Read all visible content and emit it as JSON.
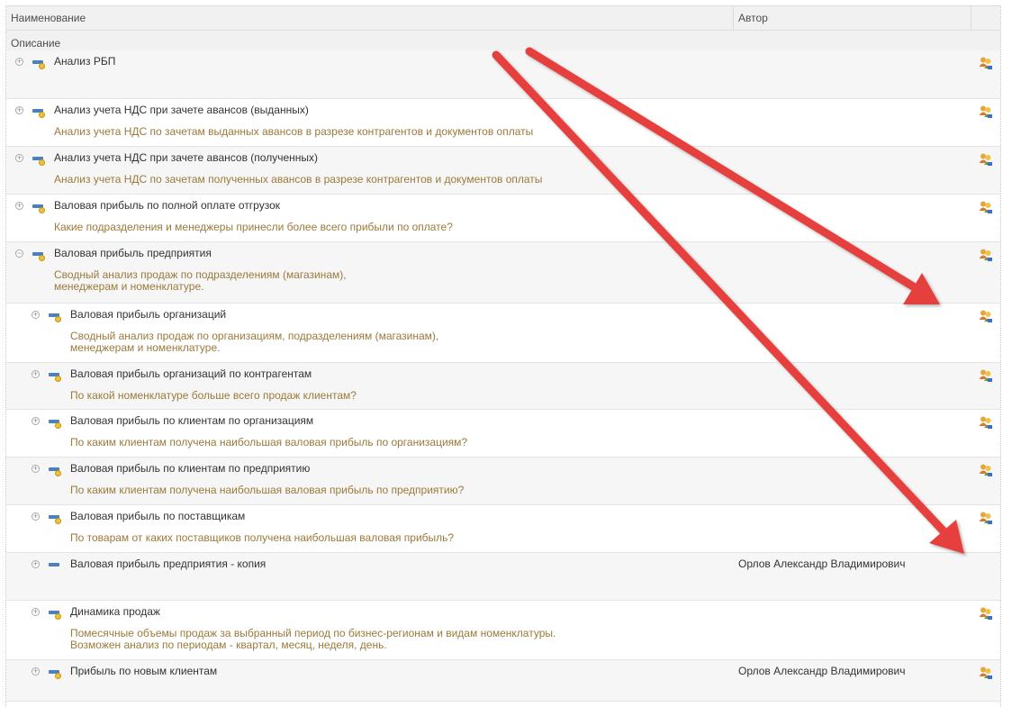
{
  "header": {
    "name": "Наименование",
    "author": "Автор",
    "description": "Описание"
  },
  "colors": {
    "title": "#333333",
    "description": "#9a7a3a",
    "arrow": "#e5413e",
    "report_icon": "#4a7fc2"
  },
  "rows": [
    {
      "title": "Анализ РБП",
      "description": "",
      "author": "",
      "level": 0,
      "expanded": false,
      "shared_icon": true
    },
    {
      "title": "Анализ учета НДС при зачете авансов (выданных)",
      "description": "Анализ учета НДС по зачетам выданных авансов в разрезе контрагентов и документов оплаты",
      "author": "",
      "level": 0,
      "expanded": false,
      "shared_icon": true
    },
    {
      "title": "Анализ учета НДС при зачете авансов (полученных)",
      "description": "Анализ учета НДС по зачетам полученных авансов в разрезе контрагентов и документов оплаты",
      "author": "",
      "level": 0,
      "expanded": false,
      "shared_icon": true
    },
    {
      "title": "Валовая прибыль по полной оплате отгрузок",
      "description": "Какие подразделения и менеджеры принесли более всего прибыли по оплате?",
      "author": "",
      "level": 0,
      "expanded": false,
      "shared_icon": true
    },
    {
      "title": "Валовая прибыль предприятия",
      "description": "Сводный анализ продаж по подразделениям (магазинам),\nменеджерам и номенклатуре.",
      "author": "",
      "level": 0,
      "expanded": true,
      "shared_icon": true
    },
    {
      "title": "Валовая прибыль организаций",
      "description": "Сводный анализ продаж по организациям, подразделениям (магазинам),\nменеджерам и номенклатуре.",
      "author": "",
      "level": 1,
      "expanded": false,
      "shared_icon": true
    },
    {
      "title": "Валовая прибыль организаций по контрагентам",
      "description": "По какой номенклатуре больше всего продаж клиентам?",
      "author": "",
      "level": 1,
      "expanded": false,
      "shared_icon": true
    },
    {
      "title": "Валовая прибыль по клиентам по организациям",
      "description": "По каким клиентам получена наибольшая валовая прибыль по организациям?",
      "author": "",
      "level": 1,
      "expanded": false,
      "shared_icon": true
    },
    {
      "title": "Валовая прибыль по клиентам по предприятию",
      "description": "По каким клиентам получена наибольшая валовая прибыль по предприятию?",
      "author": "",
      "level": 1,
      "expanded": false,
      "shared_icon": true
    },
    {
      "title": "Валовая прибыль по поставщикам",
      "description": "По товарам от каких поставщиков получена наибольшая валовая прибыль?",
      "author": "",
      "level": 1,
      "expanded": false,
      "shared_icon": true
    },
    {
      "title": "Валовая прибыль предприятия - копия",
      "description": "",
      "author": "Орлов Александр Владимирович",
      "level": 1,
      "expanded": false,
      "shared_icon": false
    },
    {
      "title": "Динамика продаж",
      "description": "Помесячные объемы продаж за выбранный период по бизнес-регионам и видам номенклатуры.\nВозможен анализ по периодам - квартал, месяц, неделя, день.",
      "author": "",
      "level": 1,
      "expanded": false,
      "shared_icon": true
    },
    {
      "title": "Прибыль по новым клиентам",
      "description": "",
      "author": "Орлов Александр Владимирович",
      "level": 1,
      "expanded": false,
      "shared_icon": true
    }
  ]
}
